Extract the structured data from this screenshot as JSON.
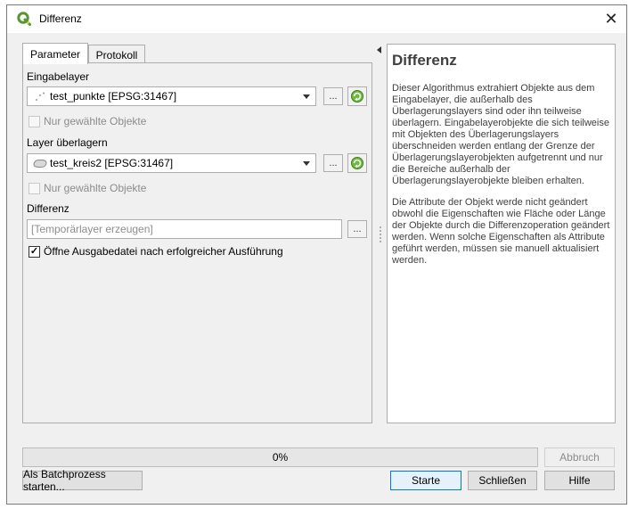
{
  "window": {
    "title": "Differenz"
  },
  "tabs": [
    {
      "label": "Parameter"
    },
    {
      "label": "Protokoll"
    }
  ],
  "params": {
    "input_label": "Eingabelayer",
    "input_value": "test_punkte [EPSG:31467]",
    "selected_only_label_1": "Nur gewählte Objekte",
    "overlay_label": "Layer überlagern",
    "overlay_value": "test_kreis2 [EPSG:31467]",
    "selected_only_label_2": "Nur gewählte Objekte",
    "output_label": "Differenz",
    "output_placeholder": "[Temporärlayer erzeugen]",
    "open_output_label": "Öffne Ausgabedatei nach erfolgreicher Ausführung",
    "browse_label": "..."
  },
  "help": {
    "title": "Differenz",
    "p1": "Dieser Algorithmus extrahiert Objekte aus dem Eingabelayer, die außerhalb des Überlagerungslayers sind oder ihn teilweise überlagern. Eingabelayerobjekte die sich teilweise mit Objekten des Überlagerungslayers überschneiden werden entlang der Grenze der Überlagerungslayerobjekten aufgetrennt und nur die Bereiche außerhalb der Überlagerungslayerobjekte bleiben erhalten.",
    "p2": "Die Attribute der Objekt werde nicht geändert obwohl die Eigenschaften wie Fläche oder Länge der Objekte durch die Differenzoperation geändert werden. Wenn solche Eigenschaften als Attribute geführt werden, müssen sie manuell aktualisiert werden."
  },
  "progress": {
    "text": "0%",
    "value": 0
  },
  "buttons": {
    "cancel": "Abbruch",
    "batch": "Als Batchprozess starten...",
    "run": "Starte",
    "close": "Schließen",
    "help": "Hilfe"
  },
  "colors": {
    "qgis_green": "#589632",
    "qgis_yellow": "#f0e64a",
    "default_button_border": "#0078d7"
  }
}
